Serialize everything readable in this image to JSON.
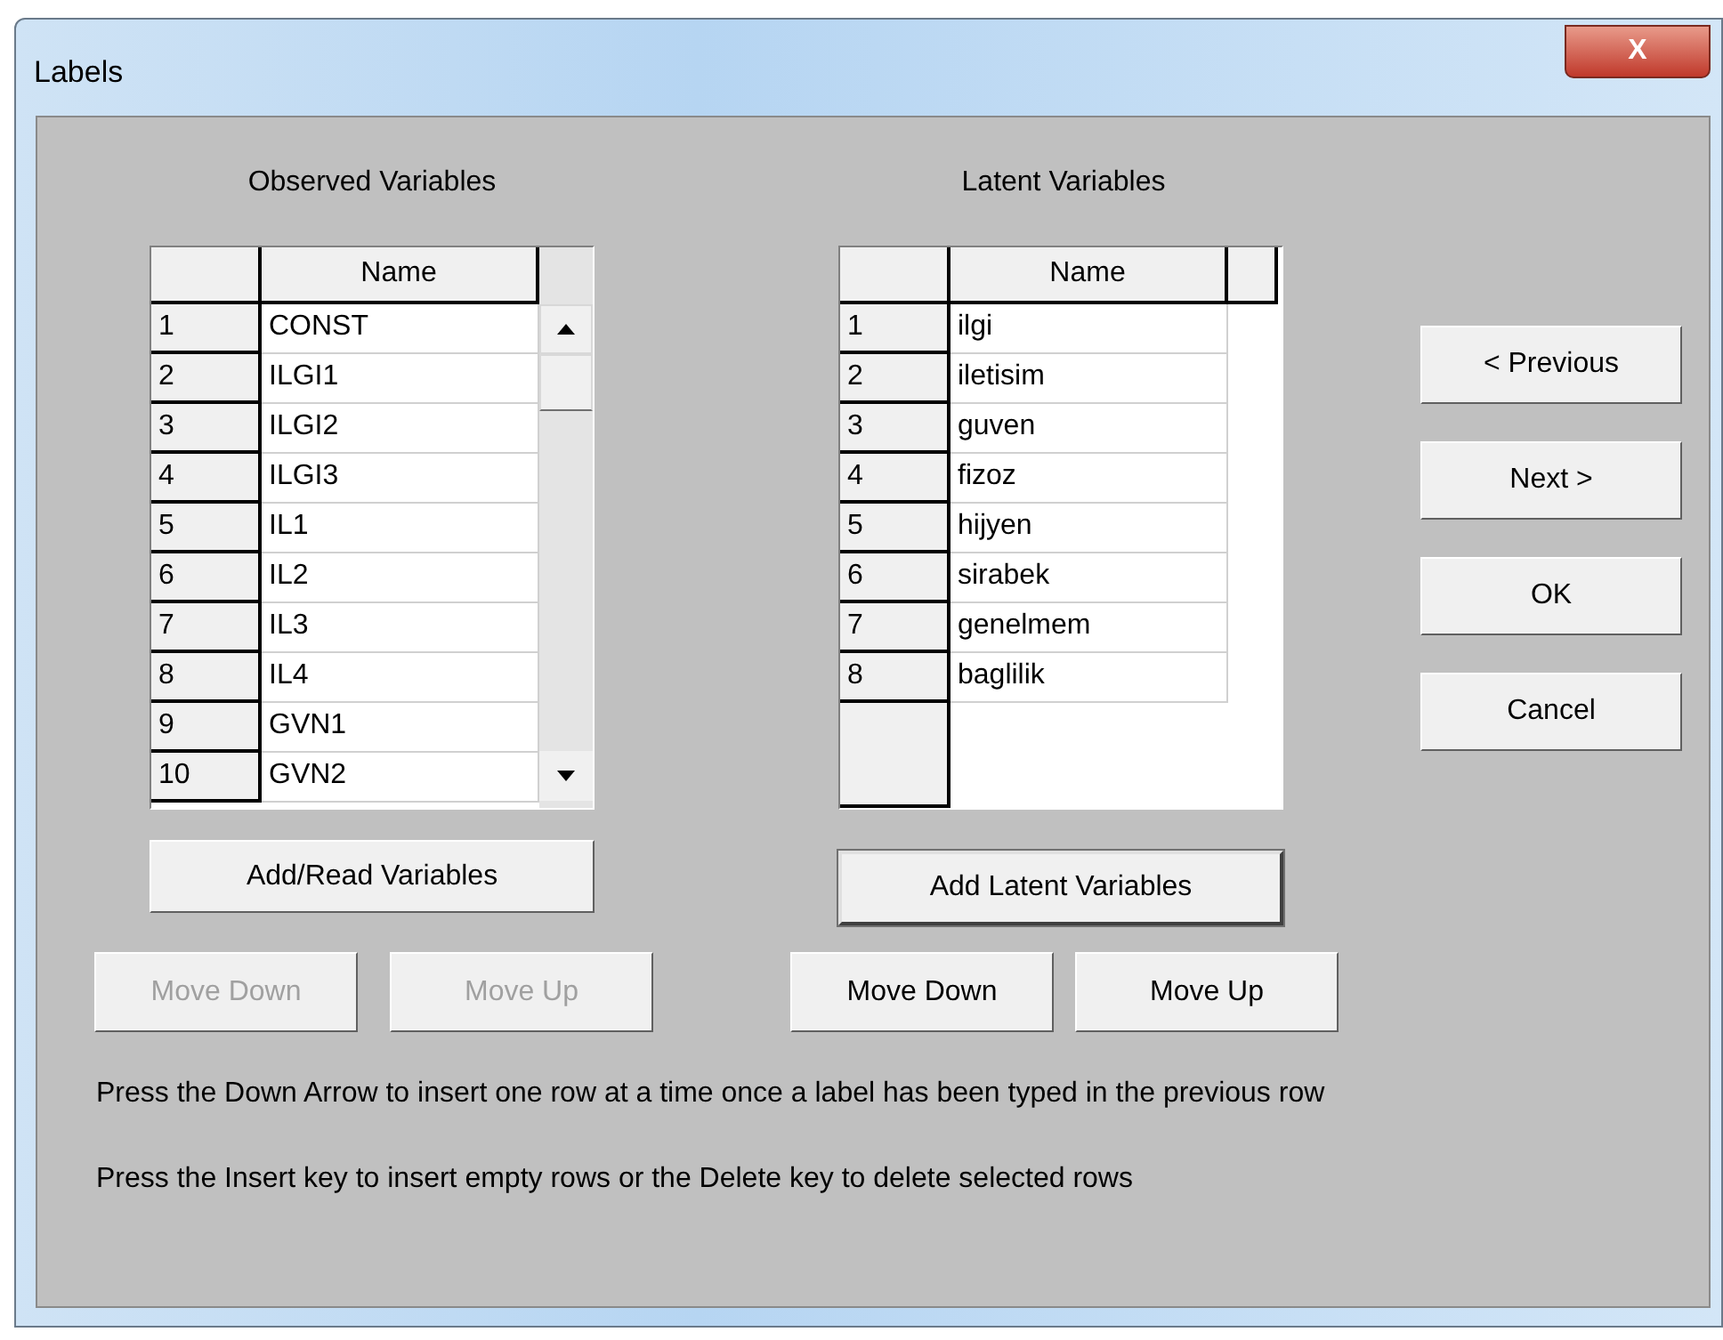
{
  "window": {
    "title": "Labels",
    "close_label": "X"
  },
  "observed": {
    "title": "Observed Variables",
    "column": "Name",
    "rows": [
      {
        "number": "1",
        "name": "CONST"
      },
      {
        "number": "2",
        "name": "ILGI1"
      },
      {
        "number": "3",
        "name": "ILGI2"
      },
      {
        "number": "4",
        "name": "ILGI3"
      },
      {
        "number": "5",
        "name": "IL1"
      },
      {
        "number": "6",
        "name": "IL2"
      },
      {
        "number": "7",
        "name": "IL3"
      },
      {
        "number": "8",
        "name": "IL4"
      },
      {
        "number": "9",
        "name": "GVN1"
      },
      {
        "number": "10",
        "name": "GVN2"
      }
    ],
    "add_button": {
      "label": "Add/Read Variables",
      "disabled": false,
      "is_default": false
    },
    "move_buttons": [
      {
        "label": "Move Down",
        "disabled": true,
        "is_default": false
      },
      {
        "label": "Move Up",
        "disabled": true,
        "is_default": false
      }
    ]
  },
  "latent": {
    "title": "Latent Variables",
    "column": "Name",
    "rows": [
      {
        "number": "1",
        "name": "ilgi"
      },
      {
        "number": "2",
        "name": "iletisim"
      },
      {
        "number": "3",
        "name": "guven"
      },
      {
        "number": "4",
        "name": "fizoz"
      },
      {
        "number": "5",
        "name": "hijyen"
      },
      {
        "number": "6",
        "name": "sirabek"
      },
      {
        "number": "7",
        "name": "genelmem"
      },
      {
        "number": "8",
        "name": "baglilik"
      }
    ],
    "add_button": {
      "label": "Add Latent Variables",
      "disabled": false,
      "is_default": true
    },
    "move_buttons": [
      {
        "label": "Move Down",
        "disabled": false,
        "is_default": false
      },
      {
        "label": "Move Up",
        "disabled": false,
        "is_default": false
      }
    ]
  },
  "nav_buttons": [
    {
      "label": "< Previous",
      "disabled": false,
      "is_default": false
    },
    {
      "label": "Next >",
      "disabled": false,
      "is_default": false
    },
    {
      "label": "OK",
      "disabled": false,
      "is_default": false
    },
    {
      "label": "Cancel",
      "disabled": false,
      "is_default": false
    }
  ],
  "hints": [
    "Press the Down Arrow to insert one row at a time once a label has been typed in the previous row",
    "Press the Insert key to insert empty rows or the Delete key to delete selected rows"
  ]
}
